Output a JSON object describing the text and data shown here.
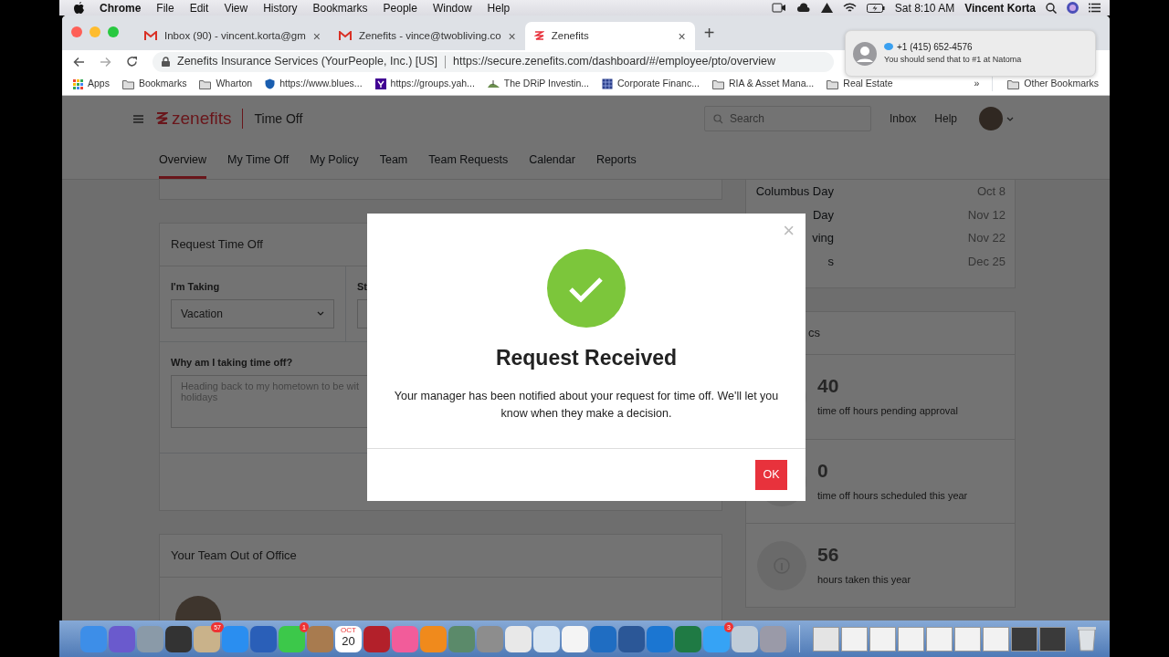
{
  "menu_bar": {
    "app": "Chrome",
    "menus": [
      "File",
      "Edit",
      "View",
      "History",
      "Bookmarks",
      "People",
      "Window",
      "Help"
    ],
    "clock": "Sat 8:10 AM",
    "user": "Vincent Korta"
  },
  "browser": {
    "tabs": [
      {
        "title": "Inbox (90) - vincent.korta@gm",
        "kind": "mail",
        "close": "×",
        "selected": false
      },
      {
        "title": "Zenefits - vince@twobliving.co",
        "kind": "mail",
        "close": "×",
        "selected": false
      },
      {
        "title": "Zenefits",
        "kind": "zenefits",
        "close": "×",
        "selected": true
      }
    ],
    "new_tab": "+",
    "address": {
      "site": "Zenefits Insurance Services (YourPeople, Inc.) [US]",
      "url": "https://secure.zenefits.com/dashboard/#/employee/pto/overview"
    },
    "bookmarks": [
      {
        "label": "Apps",
        "kind": "grid"
      },
      {
        "label": "Bookmarks",
        "kind": "folder"
      },
      {
        "label": "Wharton",
        "kind": "folder"
      },
      {
        "label": "https://www.blues...",
        "kind": "shield"
      },
      {
        "label": "https://groups.yah...",
        "kind": "letter"
      },
      {
        "label": "The DRiP Investin...",
        "kind": "hill"
      },
      {
        "label": "Corporate Financ...",
        "kind": "table"
      },
      {
        "label": "RIA & Asset Mana...",
        "kind": "folder"
      },
      {
        "label": "Real Estate",
        "kind": "folder"
      }
    ],
    "overflow": "»",
    "other_bookmarks": "Other Bookmarks"
  },
  "notification": {
    "sender": "+1 (415) 652-4576",
    "message": "You should send that to #1 at Natoma"
  },
  "app": {
    "brand": "zenefits",
    "section": "Time Off",
    "search": {
      "placeholder": "Search"
    },
    "links": [
      "Inbox",
      "Help"
    ],
    "nav": [
      {
        "label": "Overview",
        "selected": true
      },
      {
        "label": "My Time Off",
        "selected": false
      },
      {
        "label": "My Policy",
        "selected": false
      },
      {
        "label": "Team",
        "selected": false
      },
      {
        "label": "Team Requests",
        "selected": false
      },
      {
        "label": "Calendar",
        "selected": false
      },
      {
        "label": "Reports",
        "selected": false
      }
    ]
  },
  "request_card": {
    "title": "Request Time Off",
    "type_field": {
      "label": "I'm Taking",
      "value": "Vacation"
    },
    "start_field": {
      "label": "St"
    },
    "reason_field": {
      "label": "Why am I taking time off?",
      "value": "Heading back to my hometown to be wit\nholidays"
    }
  },
  "team_card": {
    "title": "Your Team Out of Office"
  },
  "holidays": [
    {
      "name": "Columbus Day",
      "date": "Oct 8"
    },
    {
      "name": "Day",
      "date": "Nov 12"
    },
    {
      "name": "ving",
      "date": "Nov 22"
    },
    {
      "name": "s",
      "date": "Dec 25"
    }
  ],
  "stats": {
    "title": "cs",
    "items": [
      {
        "value": "40",
        "label": "time off hours pending approval"
      },
      {
        "value": "0",
        "label": "time off hours scheduled this year"
      },
      {
        "value": "56",
        "label": "hours taken this year"
      }
    ]
  },
  "modal": {
    "close": "×",
    "title": "Request Received",
    "message": "Your manager has been notified about your request for time off. We'll let you know when they make a decision.",
    "button": "OK"
  },
  "dock": {
    "apps": [
      {
        "color": "#3d8ee8"
      },
      {
        "color": "#6a5acd"
      },
      {
        "color": "#8a9aa8"
      },
      {
        "color": "#333333"
      },
      {
        "color": "#c9b28a",
        "badge": "57"
      },
      {
        "color": "#2a8ef0"
      },
      {
        "color": "#2a5fb8"
      },
      {
        "color": "#3cc84a",
        "badge": "1"
      },
      {
        "color": "#a87b4f"
      },
      {
        "color": "#ffffff",
        "month": "OCT",
        "day": "20"
      },
      {
        "color": "#b3202a"
      },
      {
        "color": "#f25c9a"
      },
      {
        "color": "#f08a1c"
      },
      {
        "color": "#5b8a6a"
      },
      {
        "color": "#8d8d8d"
      },
      {
        "color": "#e8e8e8"
      },
      {
        "color": "#d9e6f2"
      },
      {
        "color": "#f4f4f4"
      },
      {
        "color": "#1f6dc2"
      },
      {
        "color": "#2b5797"
      },
      {
        "color": "#1b76d2"
      },
      {
        "color": "#1f7a44"
      },
      {
        "color": "#36a3f5",
        "badge": "3"
      },
      {
        "color": "#c0ccd8"
      },
      {
        "color": "#9a9aa8"
      }
    ],
    "documents": [
      {
        "color": "#e4e4e4"
      },
      {
        "color": "#f2f2f2"
      },
      {
        "color": "#f2f2f2"
      },
      {
        "color": "#f2f2f2"
      },
      {
        "color": "#f2f2f2"
      },
      {
        "color": "#f2f2f2"
      },
      {
        "color": "#f2f2f2"
      },
      {
        "color": "#3a3a3a"
      },
      {
        "color": "#3a3a3a"
      }
    ]
  }
}
